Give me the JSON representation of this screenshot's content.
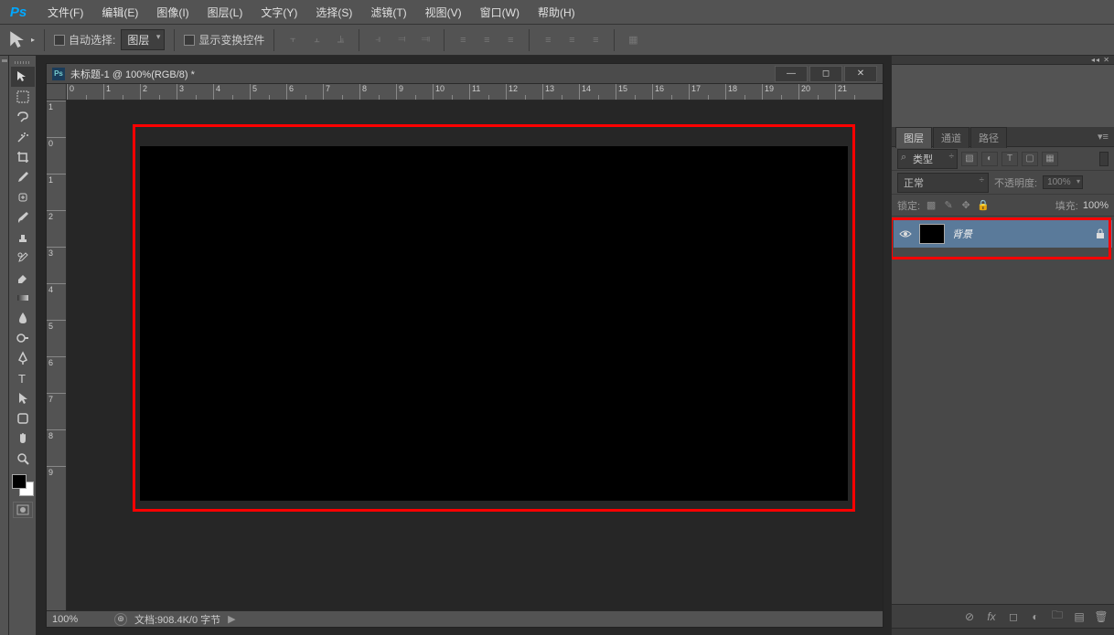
{
  "app": {
    "logo": "Ps"
  },
  "menu": {
    "file": "文件(F)",
    "edit": "编辑(E)",
    "image": "图像(I)",
    "layer": "图层(L)",
    "type": "文字(Y)",
    "select": "选择(S)",
    "filter": "滤镜(T)",
    "view": "视图(V)",
    "window": "窗口(W)",
    "help": "帮助(H)"
  },
  "options": {
    "auto_select_label": "自动选择:",
    "target_dropdown": "图层",
    "show_transform_label": "显示变换控件"
  },
  "document": {
    "title": "未标题-1 @ 100%(RGB/8) *",
    "zoom": "100%",
    "status": "文档:908.4K/0 字节",
    "ruler_h": [
      "0",
      "1",
      "2",
      "3",
      "4",
      "5",
      "6",
      "7",
      "8",
      "9",
      "10",
      "11",
      "12",
      "13",
      "14",
      "15",
      "16",
      "17",
      "18",
      "19",
      "20",
      "21"
    ],
    "ruler_v": [
      "1",
      "0",
      "1",
      "2",
      "3",
      "4",
      "5",
      "6",
      "7",
      "8",
      "9"
    ]
  },
  "panels": {
    "layers_tab": "图层",
    "channels_tab": "通道",
    "paths_tab": "路径",
    "filter_kind": "类型",
    "blend_mode": "正常",
    "opacity_label": "不透明度:",
    "opacity_value": "100%",
    "lock_label": "锁定:",
    "fill_label": "填充:",
    "fill_value": "100%",
    "layer_bg_name": "背景"
  }
}
